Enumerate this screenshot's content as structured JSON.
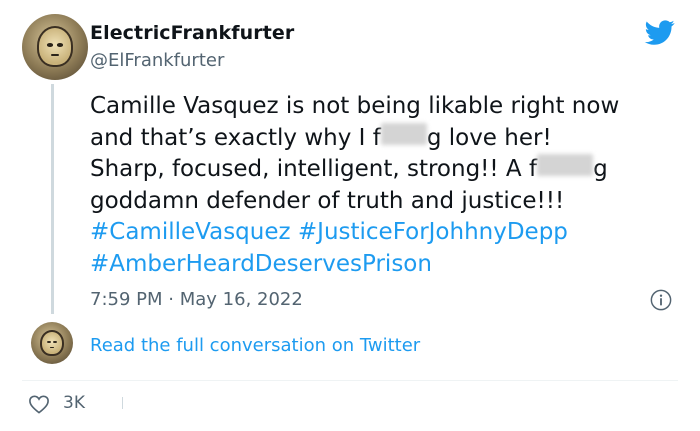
{
  "author": {
    "display_name": "ElectricFrankfurter",
    "handle": "@ElFrankfurter",
    "avatar_icon": "gold-mask-avatar"
  },
  "tweet": {
    "line1": "Camille Vasquez is not being likable right now",
    "line2_a": "and that’s exactly why I f",
    "line2_b": "g love her!",
    "line3": "Sharp, focused, intelligent, strong!! A f",
    "line3_b": "g",
    "line4": "goddamn defender of truth and justice!!!",
    "hashtags": [
      "#CamilleVasquez",
      "#JusticeForJohhnyDepp",
      "#AmberHeardDeservesPrison"
    ],
    "hashtag_color": "#1d9bf0"
  },
  "meta": {
    "time": "7:59 PM",
    "separator": "·",
    "date": "May 16, 2022"
  },
  "read_more": {
    "label": "Read the full conversation on Twitter"
  },
  "engagement": {
    "likes": "3K"
  },
  "brand": {
    "logo_icon": "twitter-bird-icon",
    "accent": "#1d9bf0"
  }
}
